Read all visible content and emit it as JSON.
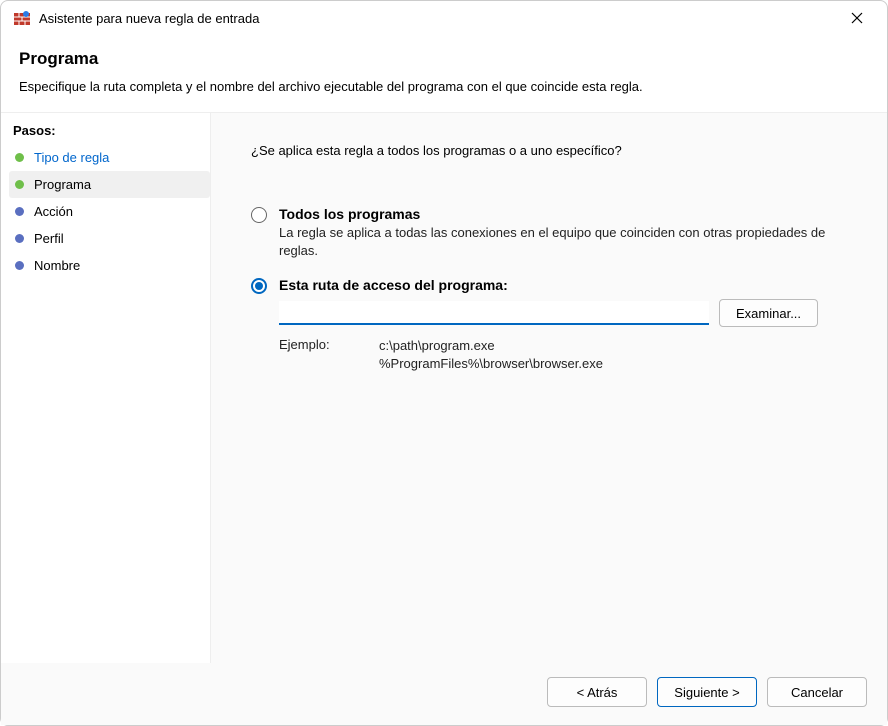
{
  "titlebar": {
    "title": "Asistente para nueva regla de entrada"
  },
  "header": {
    "heading": "Programa",
    "subtitle": "Especifique la ruta completa y el nombre del archivo ejecutable del programa con el que coincide esta regla."
  },
  "sidebar": {
    "steps_label": "Pasos:",
    "items": [
      {
        "label": "Tipo de regla",
        "state": "done"
      },
      {
        "label": "Programa",
        "state": "current"
      },
      {
        "label": "Acción",
        "state": "pending"
      },
      {
        "label": "Perfil",
        "state": "pending"
      },
      {
        "label": "Nombre",
        "state": "pending"
      }
    ]
  },
  "content": {
    "question": "¿Se aplica esta regla a todos los programas o a uno específico?",
    "option_all": {
      "title": "Todos los programas",
      "desc": "La regla se aplica a todas las conexiones en el equipo que coinciden con otras propiedades de reglas."
    },
    "option_path": {
      "title": "Esta ruta de acceso del programa:",
      "value": "",
      "browse_label": "Examinar..."
    },
    "example": {
      "label": "Ejemplo:",
      "text": "c:\\path\\program.exe\n%ProgramFiles%\\browser\\browser.exe"
    }
  },
  "footer": {
    "back": "< Atrás",
    "next": "Siguiente >",
    "cancel": "Cancelar"
  }
}
